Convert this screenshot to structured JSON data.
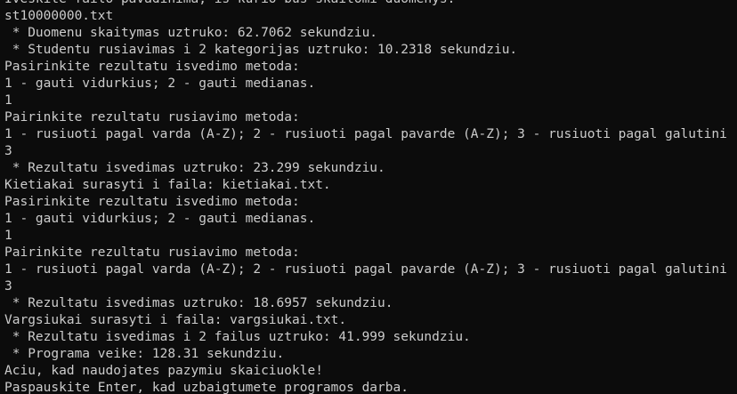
{
  "terminal": {
    "lines": [
      "Iveskite failo pavadinima, is kurio bus skaitomi duomenys:",
      "st10000000.txt",
      " * Duomenu skaitymas uztruko: 62.7062 sekundziu.",
      " * Studentu rusiavimas i 2 kategorijas uztruko: 10.2318 sekundziu.",
      "Pasirinkite rezultatu isvedimo metoda:",
      "1 - gauti vidurkius; 2 - gauti medianas.",
      "1",
      "Pairinkite rezultatu rusiavimo metoda:",
      "1 - rusiuoti pagal varda (A-Z); 2 - rusiuoti pagal pavarde (A-Z); 3 - rusiuoti pagal galutini",
      "3",
      " * Rezultatu isvedimas uztruko: 23.299 sekundziu.",
      "Kietiakai surasyti i faila: kietiakai.txt.",
      "Pasirinkite rezultatu isvedimo metoda:",
      "1 - gauti vidurkius; 2 - gauti medianas.",
      "1",
      "Pairinkite rezultatu rusiavimo metoda:",
      "1 - rusiuoti pagal varda (A-Z); 2 - rusiuoti pagal pavarde (A-Z); 3 - rusiuoti pagal galutini",
      "3",
      " * Rezultatu isvedimas uztruko: 18.6957 sekundziu.",
      "Vargsiukai surasyti i faila: vargsiukai.txt.",
      " * Rezultatu isvedimas i 2 failus uztruko: 41.999 sekundziu.",
      " * Programa veike: 128.31 sekundziu.",
      "Aciu, kad naudojates pazymiu skaiciuokle!",
      "Paspauskite Enter, kad uzbaigtumete programos darba."
    ]
  }
}
